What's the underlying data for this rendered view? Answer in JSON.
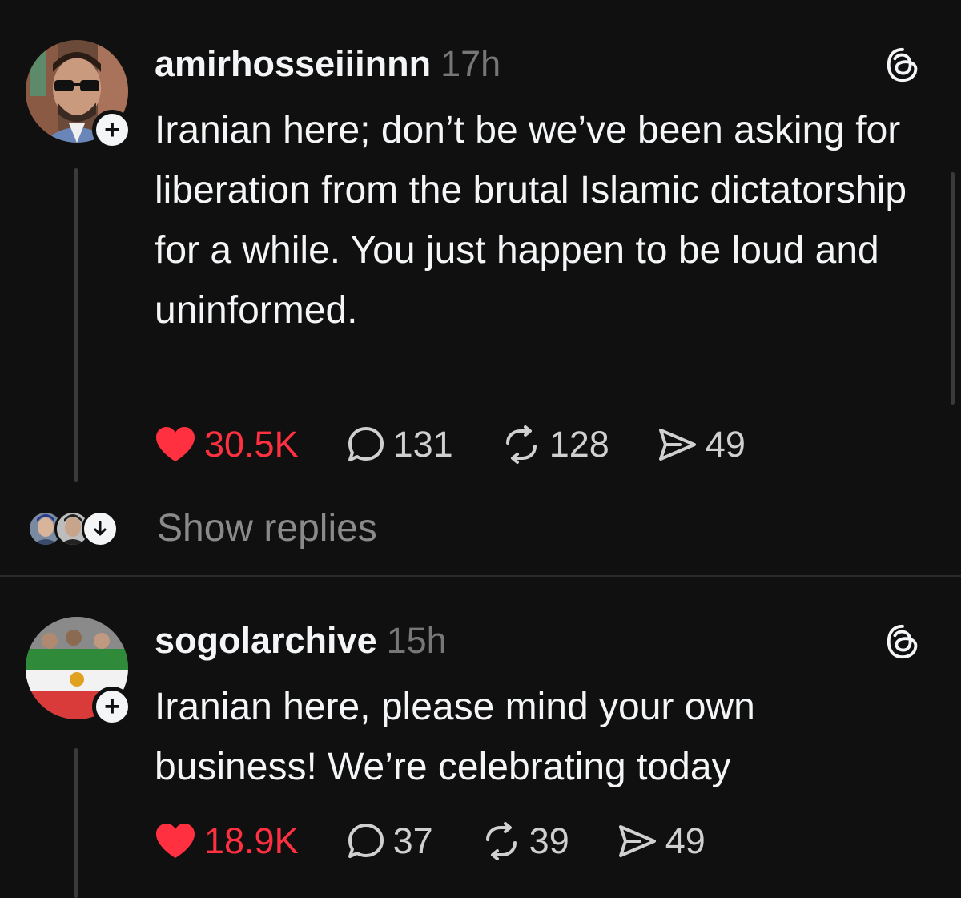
{
  "posts": [
    {
      "username": "amirhosseiiinnn",
      "timestamp": "17h",
      "text": "Iranian here; don’t be we’ve been asking for liberation from the brutal Islamic dictatorship for a while. You just happen to be loud and uninformed.",
      "likes": "30.5K",
      "replies": "131",
      "reposts": "128",
      "shares": "49"
    },
    {
      "username": "sogolarchive",
      "timestamp": "15h",
      "text": "Iranian here, please mind your own business! We’re celebrating today",
      "likes": "18.9K",
      "replies": "37",
      "reposts": "39",
      "shares": "49"
    }
  ],
  "show_replies_label": "Show replies",
  "colors": {
    "background": "#101010",
    "text": "#f3f5f7",
    "like": "#ff3040",
    "muted": "#777777"
  },
  "icons": [
    "threads-logo-icon",
    "heart-icon",
    "comment-icon",
    "repost-icon",
    "share-icon",
    "follow-plus-icon",
    "arrow-down-icon"
  ]
}
